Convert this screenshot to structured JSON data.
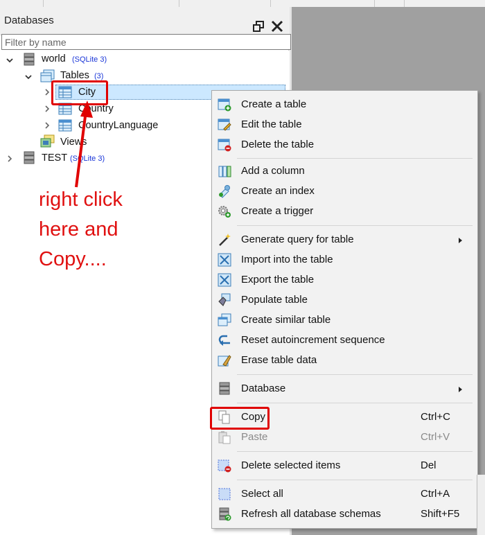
{
  "panel": {
    "title": "Databases"
  },
  "filter": {
    "placeholder": "Filter by name",
    "value": ""
  },
  "tree": {
    "world": {
      "label": "world",
      "badge": "(SQLite 3)"
    },
    "tables": {
      "label": "Tables",
      "badge": "(3)"
    },
    "items": [
      {
        "label": "City"
      },
      {
        "label": "Country"
      },
      {
        "label": "CountryLanguage"
      }
    ],
    "views": {
      "label": "Views"
    },
    "test": {
      "label": "TEST",
      "badge": "(SQLite 3)"
    }
  },
  "annotation": {
    "line1": "right click",
    "line2": "here and",
    "line3": "Copy...."
  },
  "menu": {
    "items": [
      {
        "label": "Create a table",
        "icon": "create-table-icon"
      },
      {
        "label": "Edit the table",
        "icon": "edit-table-icon"
      },
      {
        "label": "Delete the table",
        "icon": "delete-table-icon"
      },
      {
        "label": "Add a column",
        "icon": "add-column-icon"
      },
      {
        "label": "Create an index",
        "icon": "create-index-icon"
      },
      {
        "label": "Create a trigger",
        "icon": "create-trigger-icon"
      },
      {
        "label": "Generate query for table",
        "icon": "magic-wand-icon",
        "submenu": true
      },
      {
        "label": "Import into the table",
        "icon": "import-icon"
      },
      {
        "label": "Export the table",
        "icon": "export-icon"
      },
      {
        "label": "Populate table",
        "icon": "populate-icon"
      },
      {
        "label": "Create similar table",
        "icon": "similar-table-icon"
      },
      {
        "label": "Reset autoincrement sequence",
        "icon": "reset-icon"
      },
      {
        "label": "Erase table data",
        "icon": "erase-icon"
      },
      {
        "label": "Database",
        "icon": "database-icon",
        "submenu": true
      },
      {
        "label": "Copy",
        "shortcut": "Ctrl+C",
        "icon": "copy-icon"
      },
      {
        "label": "Paste",
        "shortcut": "Ctrl+V",
        "icon": "paste-icon",
        "disabled": true
      },
      {
        "label": "Delete selected items",
        "shortcut": "Del",
        "icon": "delete-selected-icon"
      },
      {
        "label": "Select all",
        "shortcut": "Ctrl+A",
        "icon": "select-all-icon"
      },
      {
        "label": "Refresh all database schemas",
        "shortcut": "Shift+F5",
        "icon": "refresh-icon"
      }
    ]
  },
  "colors": {
    "annotation": "#e00000",
    "selection": "#cce8ff",
    "menu_bg": "#f2f2f2",
    "badge": "#1a36d8"
  }
}
